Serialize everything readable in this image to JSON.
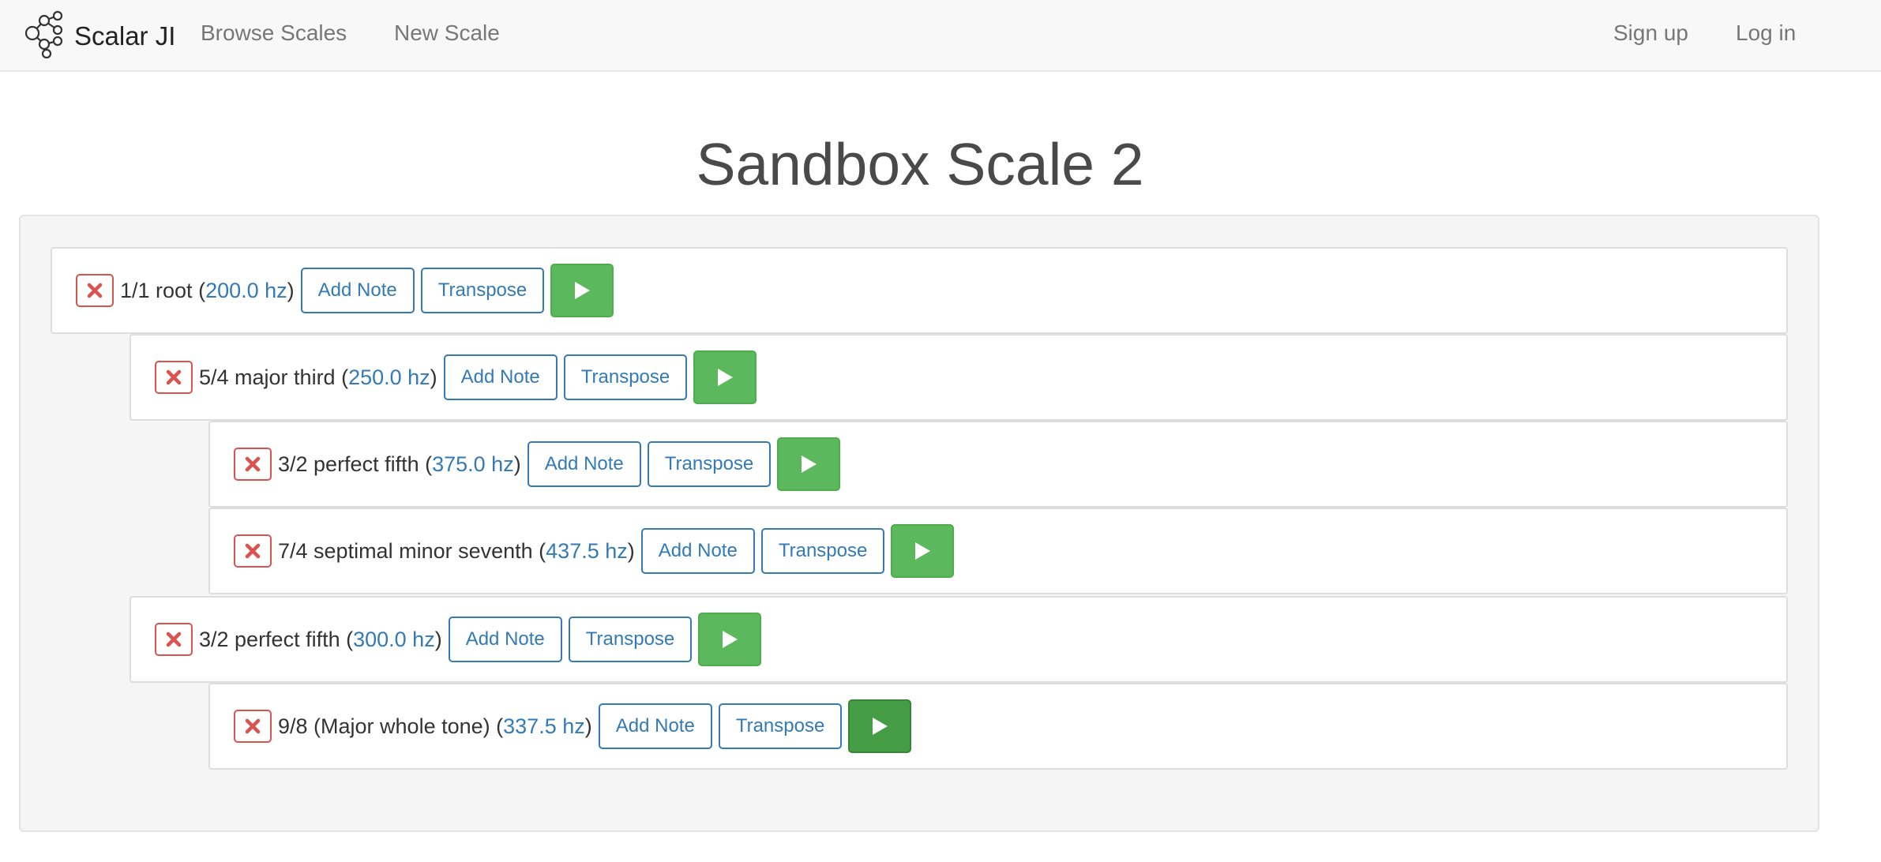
{
  "navbar": {
    "brand": "Scalar JI",
    "brand_icon": "molecule-logo-icon",
    "links": [
      "Browse Scales",
      "New Scale"
    ],
    "right_links": [
      "Sign up",
      "Log in"
    ]
  },
  "page_title": "Sandbox Scale 2",
  "buttons": {
    "add_note": "Add Note",
    "transpose": "Transpose"
  },
  "notes": [
    {
      "depth": 0,
      "label": "1/1 root",
      "hz": "200.0 hz",
      "play_active": false
    },
    {
      "depth": 1,
      "label": "5/4 major third",
      "hz": "250.0 hz",
      "play_active": false
    },
    {
      "depth": 2,
      "label": "3/2 perfect fifth",
      "hz": "375.0 hz",
      "play_active": false
    },
    {
      "depth": 2,
      "label": "7/4 septimal minor seventh",
      "hz": "437.5 hz",
      "play_active": false
    },
    {
      "depth": 1,
      "label": "3/2 perfect fifth",
      "hz": "300.0 hz",
      "play_active": false
    },
    {
      "depth": 2,
      "label": "9/8 (Major whole tone)",
      "hz": "337.5 hz",
      "play_active": true
    }
  ],
  "colors": {
    "delete": "#d9534f",
    "link_blue": "#337ab7",
    "play_green": "#5cb85c",
    "play_green_active": "#449d44"
  }
}
